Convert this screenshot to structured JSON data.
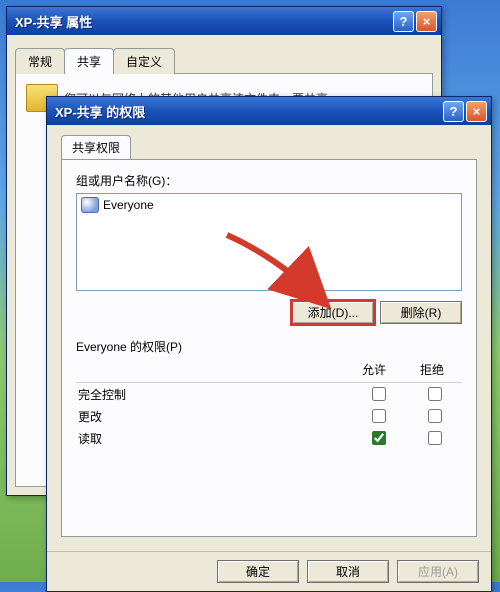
{
  "backWindow": {
    "title": "XP-共享 属性",
    "tabs": {
      "general": "常规",
      "share": "共享",
      "custom": "自定义"
    },
    "shareIntro": "您可以与网络上的其他用户共享该文件夹。要共享"
  },
  "frontWindow": {
    "title": "XP-共享 的权限",
    "tab": "共享权限",
    "groupLabel": "组或用户名称(G)：",
    "everyone": "Everyone",
    "addBtn": "添加(D)...",
    "removeBtn": "删除(R)",
    "permFor": "Everyone 的权限(P)",
    "allow": "允许",
    "deny": "拒绝",
    "perms": {
      "full": "完全控制",
      "change": "更改",
      "read": "读取"
    },
    "ok": "确定",
    "cancel": "取消",
    "apply": "应用(A)"
  }
}
